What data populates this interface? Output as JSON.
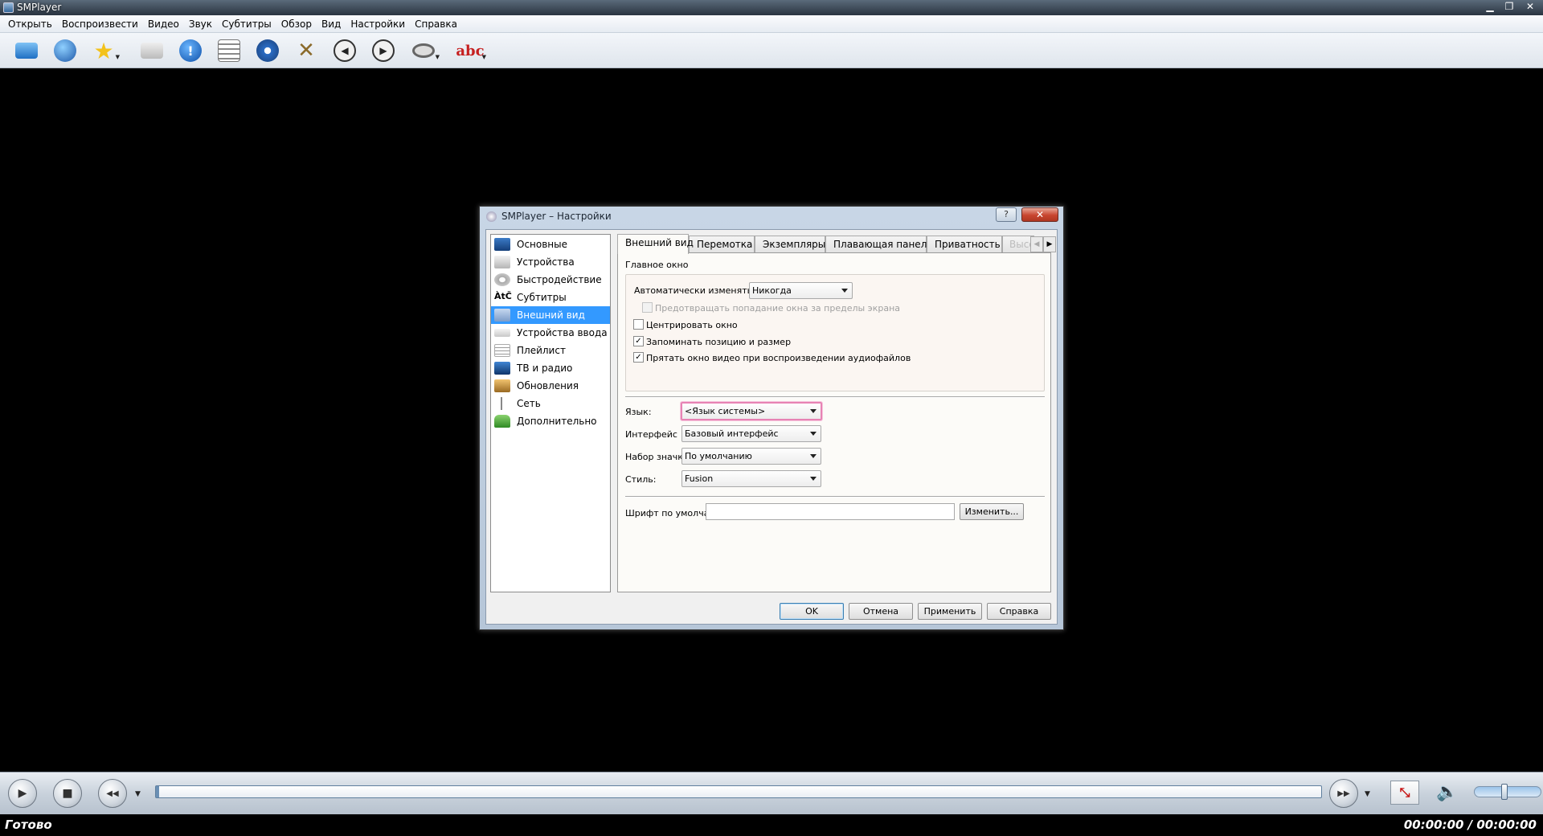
{
  "window": {
    "title": "SMPlayer",
    "minimize": "▁",
    "maximize": "❐",
    "close": "✕"
  },
  "menubar": [
    "Открыть",
    "Воспроизвести",
    "Видео",
    "Звук",
    "Субтитры",
    "Обзор",
    "Вид",
    "Настройки",
    "Справка"
  ],
  "toolbar": {
    "icons": [
      "open-folder",
      "globe",
      "favorites",
      "screenshot",
      "info",
      "playlist",
      "video-equalizer",
      "preferences",
      "previous",
      "next",
      "audio-track",
      "subtitles"
    ],
    "subtitle_glyph": "abc",
    "info_glyph": "!"
  },
  "dialog": {
    "title": "SMPlayer – Настройки",
    "help": "?",
    "close": "✕",
    "nav": [
      {
        "label": "Основные",
        "icon": "monitor",
        "color": "#2c5fa2"
      },
      {
        "label": "Устройства",
        "icon": "devices",
        "color": "#c8c8c8"
      },
      {
        "label": "Быстродействие",
        "icon": "gear",
        "color": "#d2d2d2"
      },
      {
        "label": "Субтитры",
        "icon": "subtitle-text",
        "color": "#ffffff",
        "glyph": "ÀtČ"
      },
      {
        "label": "Внешний вид",
        "icon": "appearance",
        "color": "#9fb9dd"
      },
      {
        "label": "Устройства ввода",
        "icon": "keyboard",
        "color": "#dcdcdc"
      },
      {
        "label": "Плейлист",
        "icon": "list",
        "color": "#e0e0e0"
      },
      {
        "label": "ТВ и радио",
        "icon": "tv",
        "color": "#244f86"
      },
      {
        "label": "Обновления",
        "icon": "updates",
        "color": "#c8953e"
      },
      {
        "label": "Сеть",
        "icon": "network",
        "color": "#ffffff"
      },
      {
        "label": "Дополнительно",
        "icon": "advanced",
        "color": "#5ab04a"
      }
    ],
    "selected_nav": "Внешний вид",
    "tabs": [
      "Внешний вид",
      "Перемотка",
      "Экземпляры",
      "Плавающая панель",
      "Приватность",
      "Высо"
    ],
    "tab_arrow_left": "◀",
    "tab_arrow_right": "▶",
    "main_window": {
      "heading": "Главное окно",
      "autoresize_label": "Автоматически изменять размер:",
      "autoresize_value": "Никогда",
      "prevent_offscreen_label": "Предотвращать попадание окна за пределы экрана",
      "prevent_offscreen_checked": false,
      "center_label": "Центрировать окно",
      "center_checked": false,
      "remember_label": "Запоминать позицию и размер",
      "remember_checked": true,
      "hide_video_label": "Прятать окно видео при воспроизведении аудиофайлов",
      "hide_video_checked": true,
      "check_mark": "✓"
    },
    "language_label": "Язык:",
    "language_value": "<Язык системы>",
    "interface_label": "Интерфейс",
    "interface_value": "Базовый интерфейс",
    "iconset_label": "Набор значков:",
    "iconset_value": "По умолчанию",
    "style_label": "Стиль:",
    "style_value": "Fusion",
    "font_label": "Шрифт по умолчанию:",
    "font_value": "",
    "change_button": "Изменить...",
    "buttons": {
      "ok": "OK",
      "cancel": "Отмена",
      "apply": "Применить",
      "help": "Справка"
    }
  },
  "controlbar": {
    "play": "▶",
    "stop": "■",
    "rewind": "◀◀",
    "forward": "▶▶",
    "dropdown": "▼",
    "fullscreen": "⤡",
    "volume": "🔈",
    "volume_level": 0.45,
    "progress": 0.0
  },
  "status": {
    "text": "Готово",
    "time": "00:00:00 / 00:00:00"
  }
}
